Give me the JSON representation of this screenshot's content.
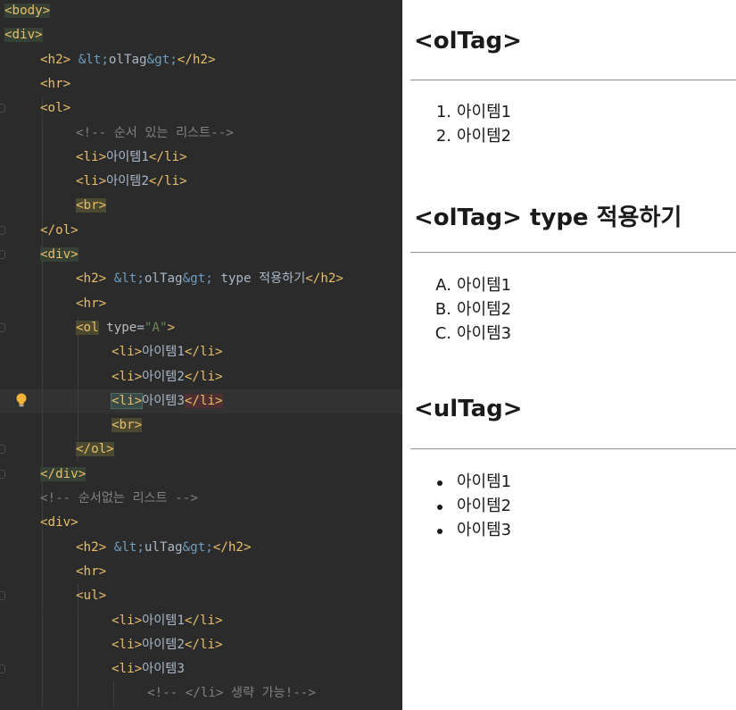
{
  "editor": {
    "code_lines": [
      {
        "tokens": [
          [
            "tag",
            "<body>"
          ]
        ]
      },
      {
        "tokens": [
          [
            "tag",
            "<div>"
          ]
        ]
      },
      {
        "tokens": [
          [
            "tag",
            "<h2>"
          ],
          [
            "txt",
            " "
          ],
          [
            "ent",
            "&lt;"
          ],
          [
            "txt",
            "olTag"
          ],
          [
            "ent",
            "&gt;"
          ],
          [
            "tag",
            "</h2>"
          ]
        ]
      },
      {
        "tokens": [
          [
            "tag",
            "<hr>"
          ]
        ]
      },
      {
        "tokens": [
          [
            "tag",
            "<ol>"
          ]
        ]
      },
      {
        "tokens": [
          [
            "cmt",
            "<!-- 순서 있는 리스트-->"
          ]
        ]
      },
      {
        "tokens": [
          [
            "tag",
            "<li>"
          ],
          [
            "txt",
            "아이템1"
          ],
          [
            "tag",
            "</li>"
          ]
        ]
      },
      {
        "tokens": [
          [
            "tag",
            "<li>"
          ],
          [
            "txt",
            "아이템2"
          ],
          [
            "tag",
            "</li>"
          ]
        ]
      },
      {
        "tokens": [
          [
            "tag",
            "<br>"
          ]
        ]
      },
      {
        "tokens": [
          [
            "tag",
            "</ol>"
          ]
        ]
      },
      {
        "tokens": [
          [
            "tag",
            "<div>"
          ]
        ]
      },
      {
        "tokens": [
          [
            "tag",
            "<h2>"
          ],
          [
            "txt",
            " "
          ],
          [
            "ent",
            "&lt;"
          ],
          [
            "txt",
            "olTag"
          ],
          [
            "ent",
            "&gt;"
          ],
          [
            "txt",
            " type 적용하기"
          ],
          [
            "tag",
            "</h2>"
          ]
        ]
      },
      {
        "tokens": [
          [
            "tag",
            "<hr>"
          ]
        ]
      },
      {
        "tokens": [
          [
            "tag",
            "<ol"
          ],
          [
            "txt",
            " "
          ],
          [
            "attr",
            "type"
          ],
          [
            "txt",
            "="
          ],
          [
            "val",
            "\"A\""
          ],
          [
            "tag",
            ">"
          ]
        ]
      },
      {
        "tokens": [
          [
            "tag",
            "<li>"
          ],
          [
            "txt",
            "아이템1"
          ],
          [
            "tag",
            "</li>"
          ]
        ]
      },
      {
        "tokens": [
          [
            "tag",
            "<li>"
          ],
          [
            "txt",
            "아이템2"
          ],
          [
            "tag",
            "</li>"
          ]
        ]
      },
      {
        "tokens": [
          [
            "tag",
            "<li>"
          ],
          [
            "txt",
            "아이템3"
          ],
          [
            "tag",
            "</li>"
          ]
        ]
      },
      {
        "tokens": [
          [
            "tag",
            "<br>"
          ]
        ]
      },
      {
        "tokens": [
          [
            "tag",
            "</ol>"
          ]
        ]
      },
      {
        "tokens": [
          [
            "tag",
            "</div>"
          ]
        ]
      },
      {
        "tokens": [
          [
            "cmt",
            "<!-- 순서없는 리스트 -->"
          ]
        ]
      },
      {
        "tokens": [
          [
            "tag",
            "<div>"
          ]
        ]
      },
      {
        "tokens": [
          [
            "tag",
            "<h2>"
          ],
          [
            "txt",
            " "
          ],
          [
            "ent",
            "&lt;"
          ],
          [
            "txt",
            "ulTag"
          ],
          [
            "ent",
            "&gt;"
          ],
          [
            "tag",
            "</h2>"
          ]
        ]
      },
      {
        "tokens": [
          [
            "tag",
            "<hr>"
          ]
        ]
      },
      {
        "tokens": [
          [
            "tag",
            "<ul>"
          ]
        ]
      },
      {
        "tokens": [
          [
            "tag",
            "<li>"
          ],
          [
            "txt",
            "아이템1"
          ],
          [
            "tag",
            "</li>"
          ]
        ]
      },
      {
        "tokens": [
          [
            "tag",
            "<li>"
          ],
          [
            "txt",
            "아이템2"
          ],
          [
            "tag",
            "</li>"
          ]
        ]
      },
      {
        "tokens": [
          [
            "tag",
            "<li>"
          ],
          [
            "txt",
            "아이템3"
          ]
        ]
      },
      {
        "tokens": [
          [
            "cmt",
            "<!-- </li> 생략 가능!-->"
          ]
        ]
      }
    ],
    "intention_bulb_icon": "lightbulb-icon"
  },
  "preview": {
    "sections": [
      {
        "heading": "<olTag>",
        "markers": [
          "1.",
          "2."
        ],
        "items": [
          "아이템1",
          "아이템2"
        ]
      },
      {
        "heading": "<olTag> type 적용하기",
        "markers": [
          "A.",
          "B.",
          "C."
        ],
        "items": [
          "아이템1",
          "아이템2",
          "아이템3"
        ]
      },
      {
        "heading": "<ulTag>",
        "markers": [
          "bullet",
          "bullet",
          "bullet"
        ],
        "items": [
          "아이템1",
          "아이템2",
          "아이템3"
        ]
      }
    ]
  },
  "colors": {
    "editor_background": "#2b2b2b",
    "tag": "#e8bf6a",
    "entity": "#6d9cbe",
    "comment": "#808080",
    "attribute_value": "#6a8759",
    "preview_background": "#ffffff"
  }
}
